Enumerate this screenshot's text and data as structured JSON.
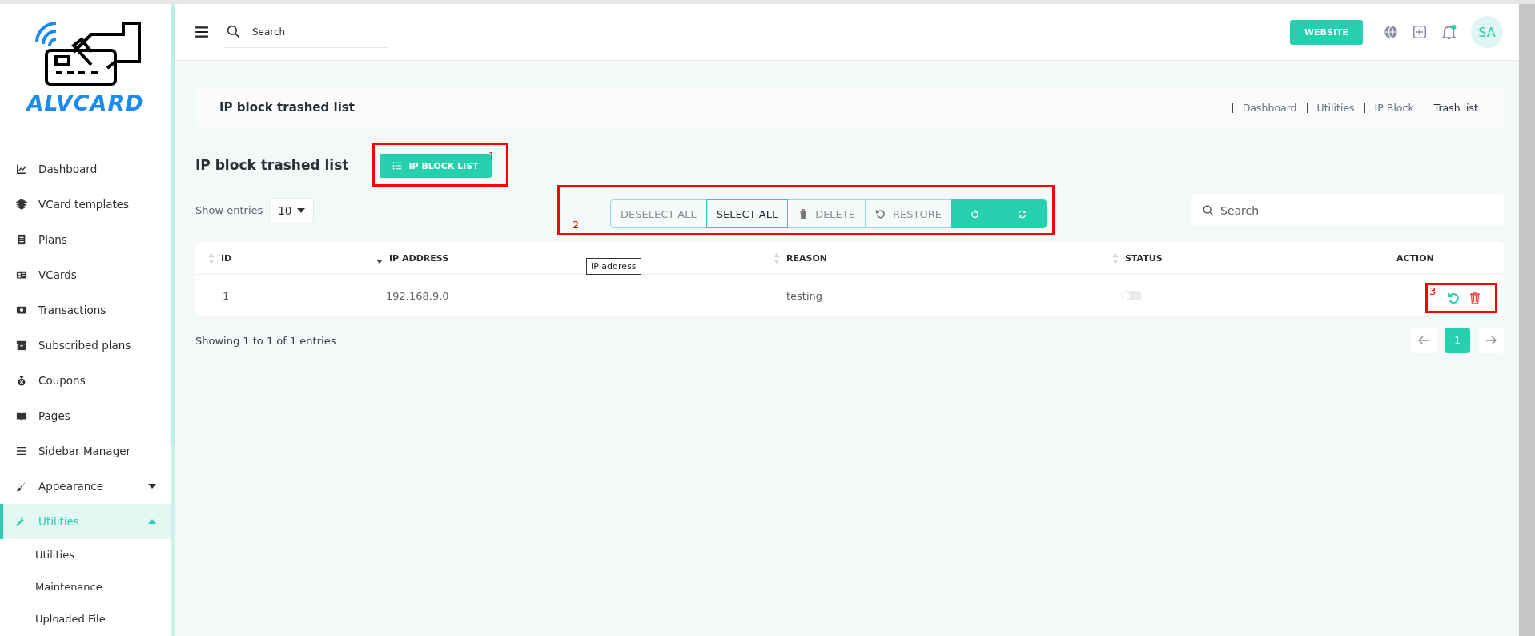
{
  "logo": {
    "text": "ALVCARD"
  },
  "sidebar": {
    "items": [
      {
        "label": "Dashboard",
        "kind": "link",
        "selected": false
      },
      {
        "label": "VCard templates",
        "kind": "link",
        "selected": false
      },
      {
        "label": "Plans",
        "kind": "link",
        "selected": false
      },
      {
        "label": "VCards",
        "kind": "link",
        "selected": false
      },
      {
        "label": "Transactions",
        "kind": "link",
        "selected": false
      },
      {
        "label": "Subscribed plans",
        "kind": "link",
        "selected": false
      },
      {
        "label": "Coupons",
        "kind": "link",
        "selected": false
      },
      {
        "label": "Pages",
        "kind": "link",
        "selected": false
      },
      {
        "label": "Sidebar Manager",
        "kind": "link",
        "selected": false
      },
      {
        "label": "Appearance",
        "kind": "group",
        "selected": false,
        "expanded": false
      },
      {
        "label": "Utilities",
        "kind": "group",
        "selected": true,
        "expanded": true,
        "children": [
          {
            "label": "Utilities"
          },
          {
            "label": "Maintenance"
          },
          {
            "label": "Uploaded File"
          }
        ]
      }
    ]
  },
  "header": {
    "search": {
      "placeholder": "Search"
    },
    "website_button": "WEBSITE",
    "avatar": "SA"
  },
  "page_header": {
    "title": "IP block trashed list",
    "breadcrumbs": [
      {
        "label": "Dashboard",
        "current": false
      },
      {
        "label": "Utilities",
        "current": false
      },
      {
        "label": "IP Block",
        "current": false
      },
      {
        "label": "Trash list",
        "current": true
      }
    ]
  },
  "section": {
    "title": "IP block trashed list",
    "list_button": "IP BLOCK LIST",
    "annotation": "1"
  },
  "controls": {
    "show_entries_label": "Show entries",
    "entries_value": "10",
    "annotation": "2",
    "buttons": [
      {
        "label": "DESELECT ALL",
        "kind": "outline",
        "selected": false
      },
      {
        "label": "SELECT ALL",
        "kind": "outline",
        "selected": true
      },
      {
        "label": "DELETE",
        "kind": "outline",
        "selected": false
      },
      {
        "label": "RESTORE",
        "kind": "outline",
        "selected": false
      },
      {
        "kind": "filled",
        "selected": false
      },
      {
        "kind": "filled",
        "selected": false
      }
    ],
    "search": {
      "placeholder": "Search"
    }
  },
  "table": {
    "columns": [
      {
        "label": "ID",
        "sortable": true,
        "sorted": false
      },
      {
        "label": "IP ADDRESS",
        "sortable": true,
        "sorted": true
      },
      {
        "label": "REASON",
        "sortable": true,
        "sorted": false
      },
      {
        "label": "STATUS",
        "sortable": true,
        "sorted": false
      },
      {
        "label": "ACTION",
        "sortable": false
      }
    ],
    "tooltip": "IP address",
    "rows": [
      {
        "id": "1",
        "ip_address": "192.168.9.0",
        "reason": "testing",
        "status_on": false,
        "annotation": "3"
      }
    ]
  },
  "footer": {
    "info": "Showing 1 to 1 of 1 entries",
    "pages": [
      {
        "label": "1",
        "selected": true
      }
    ]
  }
}
